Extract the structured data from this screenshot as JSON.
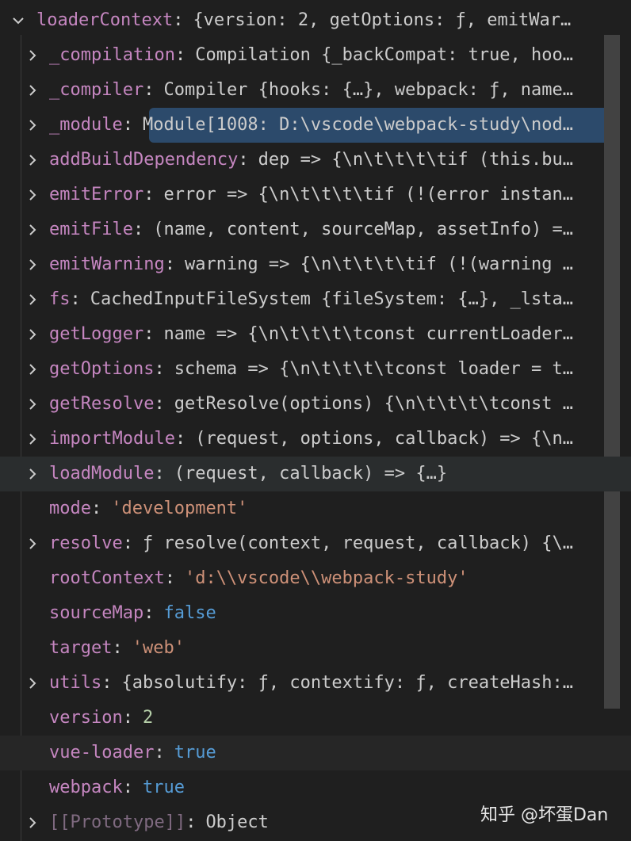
{
  "root": {
    "key": "loaderContext",
    "value": "{version: 2, getOptions: ƒ, emitWar…"
  },
  "rows": [
    {
      "key": "_compilation",
      "value": "Compilation {_backCompat: true, hoo…",
      "type": "obj",
      "expandable": true
    },
    {
      "key": "_compiler",
      "value": "Compiler {hooks: {…}, webpack: ƒ, name…",
      "type": "obj",
      "expandable": true
    },
    {
      "key": "_module",
      "value": "Module[1008: D:\\vscode\\webpack-study\\nod…",
      "type": "obj",
      "expandable": true,
      "selected": true
    },
    {
      "key": "addBuildDependency",
      "value": "dep => {\\n\\t\\t\\t\\tif (this.bu…",
      "type": "obj",
      "expandable": true
    },
    {
      "key": "emitError",
      "value": "error => {\\n\\t\\t\\t\\tif (!(error instan…",
      "type": "obj",
      "expandable": true
    },
    {
      "key": "emitFile",
      "value": "(name, content, sourceMap, assetInfo) =…",
      "type": "obj",
      "expandable": true
    },
    {
      "key": "emitWarning",
      "value": "warning => {\\n\\t\\t\\t\\tif (!(warning …",
      "type": "obj",
      "expandable": true
    },
    {
      "key": "fs",
      "value": "CachedInputFileSystem {fileSystem: {…}, _lsta…",
      "type": "obj",
      "expandable": true
    },
    {
      "key": "getLogger",
      "value": "name => {\\n\\t\\t\\t\\tconst currentLoader…",
      "type": "obj",
      "expandable": true
    },
    {
      "key": "getOptions",
      "value": "schema => {\\n\\t\\t\\t\\tconst loader = t…",
      "type": "obj",
      "expandable": true
    },
    {
      "key": "getResolve",
      "value": "getResolve(options) {\\n\\t\\t\\t\\tconst …",
      "type": "obj",
      "expandable": true
    },
    {
      "key": "importModule",
      "value": "(request, options, callback) => {\\n…",
      "type": "obj",
      "expandable": true
    },
    {
      "key": "loadModule",
      "value": "(request, callback) => {…}",
      "type": "obj",
      "expandable": true,
      "hover": true
    },
    {
      "key": "mode",
      "value": "'development'",
      "type": "str",
      "expandable": false
    },
    {
      "key": "resolve",
      "value": "ƒ resolve(context, request, callback) {\\…",
      "type": "obj",
      "expandable": true
    },
    {
      "key": "rootContext",
      "value": "'d:\\\\vscode\\\\webpack-study'",
      "type": "str",
      "expandable": false
    },
    {
      "key": "sourceMap",
      "value": "false",
      "type": "bool",
      "expandable": false
    },
    {
      "key": "target",
      "value": "'web'",
      "type": "str",
      "expandable": false
    },
    {
      "key": "utils",
      "value": "{absolutify: ƒ, contextify: ƒ, createHash:…",
      "type": "obj",
      "expandable": true
    },
    {
      "key": "version",
      "value": "2",
      "type": "num",
      "expandable": false
    },
    {
      "key": "vue-loader",
      "value": "true",
      "type": "bool",
      "expandable": false,
      "hover": true
    },
    {
      "key": "webpack",
      "value": "true",
      "type": "bool",
      "expandable": false
    },
    {
      "key": "[[Prototype]]",
      "value": "Object",
      "type": "obj",
      "expandable": true,
      "dim": true
    }
  ],
  "watermark": "知乎 @坏蛋Dan"
}
